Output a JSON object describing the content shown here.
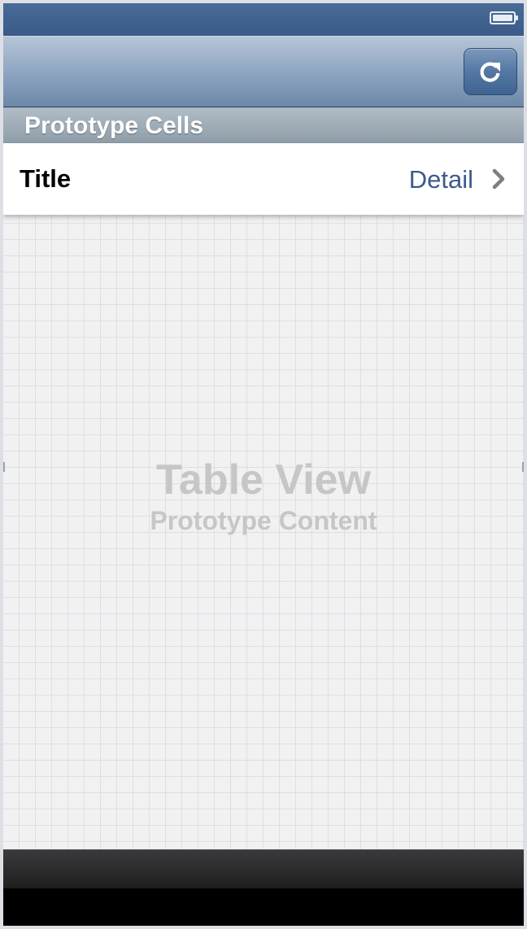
{
  "status_bar": {
    "battery_icon": "battery-full-icon"
  },
  "nav_bar": {
    "refresh_icon": "refresh-icon"
  },
  "table": {
    "section_header": "Prototype Cells",
    "cells": [
      {
        "title": "Title",
        "detail": "Detail",
        "accessory_icon": "chevron-right-icon"
      }
    ],
    "placeholder": {
      "title": "Table View",
      "subtitle": "Prototype Content"
    }
  },
  "colors": {
    "status_bar": "#3f5f8c",
    "nav_bar": "#8fa6c1",
    "detail_text": "#3c5a8c",
    "toolbar": "#1f1f20"
  }
}
